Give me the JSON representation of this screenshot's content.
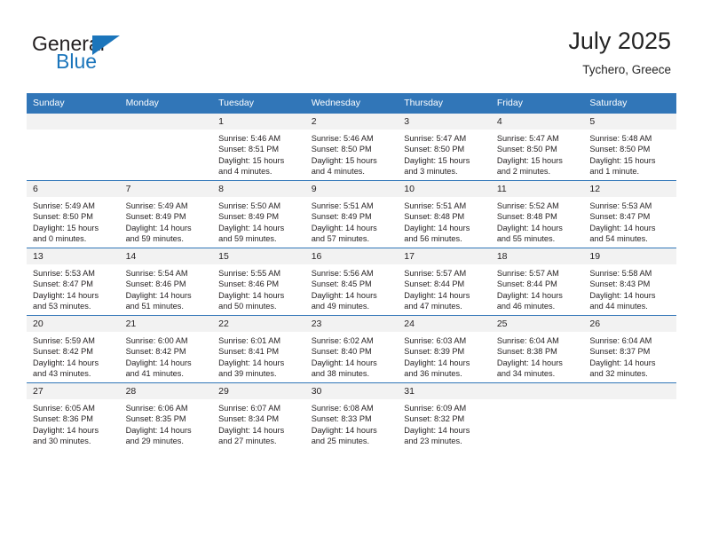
{
  "logo": {
    "word1": "General",
    "word2": "Blue",
    "triangle_color": "#1b75bb"
  },
  "header": {
    "title": "July 2025",
    "subtitle": "Tychero, Greece"
  },
  "theme": {
    "header_blue": "#3176b8",
    "daynum_gray": "#f2f2f2",
    "text": "#231f20"
  },
  "calendar": {
    "weekday_headers": [
      "Sunday",
      "Monday",
      "Tuesday",
      "Wednesday",
      "Thursday",
      "Friday",
      "Saturday"
    ],
    "weeks": [
      [
        {
          "day": "",
          "sunrise": "",
          "sunset": "",
          "daylight1": "",
          "daylight2": ""
        },
        {
          "day": "",
          "sunrise": "",
          "sunset": "",
          "daylight1": "",
          "daylight2": ""
        },
        {
          "day": "1",
          "sunrise": "Sunrise: 5:46 AM",
          "sunset": "Sunset: 8:51 PM",
          "daylight1": "Daylight: 15 hours",
          "daylight2": "and 4 minutes."
        },
        {
          "day": "2",
          "sunrise": "Sunrise: 5:46 AM",
          "sunset": "Sunset: 8:50 PM",
          "daylight1": "Daylight: 15 hours",
          "daylight2": "and 4 minutes."
        },
        {
          "day": "3",
          "sunrise": "Sunrise: 5:47 AM",
          "sunset": "Sunset: 8:50 PM",
          "daylight1": "Daylight: 15 hours",
          "daylight2": "and 3 minutes."
        },
        {
          "day": "4",
          "sunrise": "Sunrise: 5:47 AM",
          "sunset": "Sunset: 8:50 PM",
          "daylight1": "Daylight: 15 hours",
          "daylight2": "and 2 minutes."
        },
        {
          "day": "5",
          "sunrise": "Sunrise: 5:48 AM",
          "sunset": "Sunset: 8:50 PM",
          "daylight1": "Daylight: 15 hours",
          "daylight2": "and 1 minute."
        }
      ],
      [
        {
          "day": "6",
          "sunrise": "Sunrise: 5:49 AM",
          "sunset": "Sunset: 8:50 PM",
          "daylight1": "Daylight: 15 hours",
          "daylight2": "and 0 minutes."
        },
        {
          "day": "7",
          "sunrise": "Sunrise: 5:49 AM",
          "sunset": "Sunset: 8:49 PM",
          "daylight1": "Daylight: 14 hours",
          "daylight2": "and 59 minutes."
        },
        {
          "day": "8",
          "sunrise": "Sunrise: 5:50 AM",
          "sunset": "Sunset: 8:49 PM",
          "daylight1": "Daylight: 14 hours",
          "daylight2": "and 59 minutes."
        },
        {
          "day": "9",
          "sunrise": "Sunrise: 5:51 AM",
          "sunset": "Sunset: 8:49 PM",
          "daylight1": "Daylight: 14 hours",
          "daylight2": "and 57 minutes."
        },
        {
          "day": "10",
          "sunrise": "Sunrise: 5:51 AM",
          "sunset": "Sunset: 8:48 PM",
          "daylight1": "Daylight: 14 hours",
          "daylight2": "and 56 minutes."
        },
        {
          "day": "11",
          "sunrise": "Sunrise: 5:52 AM",
          "sunset": "Sunset: 8:48 PM",
          "daylight1": "Daylight: 14 hours",
          "daylight2": "and 55 minutes."
        },
        {
          "day": "12",
          "sunrise": "Sunrise: 5:53 AM",
          "sunset": "Sunset: 8:47 PM",
          "daylight1": "Daylight: 14 hours",
          "daylight2": "and 54 minutes."
        }
      ],
      [
        {
          "day": "13",
          "sunrise": "Sunrise: 5:53 AM",
          "sunset": "Sunset: 8:47 PM",
          "daylight1": "Daylight: 14 hours",
          "daylight2": "and 53 minutes."
        },
        {
          "day": "14",
          "sunrise": "Sunrise: 5:54 AM",
          "sunset": "Sunset: 8:46 PM",
          "daylight1": "Daylight: 14 hours",
          "daylight2": "and 51 minutes."
        },
        {
          "day": "15",
          "sunrise": "Sunrise: 5:55 AM",
          "sunset": "Sunset: 8:46 PM",
          "daylight1": "Daylight: 14 hours",
          "daylight2": "and 50 minutes."
        },
        {
          "day": "16",
          "sunrise": "Sunrise: 5:56 AM",
          "sunset": "Sunset: 8:45 PM",
          "daylight1": "Daylight: 14 hours",
          "daylight2": "and 49 minutes."
        },
        {
          "day": "17",
          "sunrise": "Sunrise: 5:57 AM",
          "sunset": "Sunset: 8:44 PM",
          "daylight1": "Daylight: 14 hours",
          "daylight2": "and 47 minutes."
        },
        {
          "day": "18",
          "sunrise": "Sunrise: 5:57 AM",
          "sunset": "Sunset: 8:44 PM",
          "daylight1": "Daylight: 14 hours",
          "daylight2": "and 46 minutes."
        },
        {
          "day": "19",
          "sunrise": "Sunrise: 5:58 AM",
          "sunset": "Sunset: 8:43 PM",
          "daylight1": "Daylight: 14 hours",
          "daylight2": "and 44 minutes."
        }
      ],
      [
        {
          "day": "20",
          "sunrise": "Sunrise: 5:59 AM",
          "sunset": "Sunset: 8:42 PM",
          "daylight1": "Daylight: 14 hours",
          "daylight2": "and 43 minutes."
        },
        {
          "day": "21",
          "sunrise": "Sunrise: 6:00 AM",
          "sunset": "Sunset: 8:42 PM",
          "daylight1": "Daylight: 14 hours",
          "daylight2": "and 41 minutes."
        },
        {
          "day": "22",
          "sunrise": "Sunrise: 6:01 AM",
          "sunset": "Sunset: 8:41 PM",
          "daylight1": "Daylight: 14 hours",
          "daylight2": "and 39 minutes."
        },
        {
          "day": "23",
          "sunrise": "Sunrise: 6:02 AM",
          "sunset": "Sunset: 8:40 PM",
          "daylight1": "Daylight: 14 hours",
          "daylight2": "and 38 minutes."
        },
        {
          "day": "24",
          "sunrise": "Sunrise: 6:03 AM",
          "sunset": "Sunset: 8:39 PM",
          "daylight1": "Daylight: 14 hours",
          "daylight2": "and 36 minutes."
        },
        {
          "day": "25",
          "sunrise": "Sunrise: 6:04 AM",
          "sunset": "Sunset: 8:38 PM",
          "daylight1": "Daylight: 14 hours",
          "daylight2": "and 34 minutes."
        },
        {
          "day": "26",
          "sunrise": "Sunrise: 6:04 AM",
          "sunset": "Sunset: 8:37 PM",
          "daylight1": "Daylight: 14 hours",
          "daylight2": "and 32 minutes."
        }
      ],
      [
        {
          "day": "27",
          "sunrise": "Sunrise: 6:05 AM",
          "sunset": "Sunset: 8:36 PM",
          "daylight1": "Daylight: 14 hours",
          "daylight2": "and 30 minutes."
        },
        {
          "day": "28",
          "sunrise": "Sunrise: 6:06 AM",
          "sunset": "Sunset: 8:35 PM",
          "daylight1": "Daylight: 14 hours",
          "daylight2": "and 29 minutes."
        },
        {
          "day": "29",
          "sunrise": "Sunrise: 6:07 AM",
          "sunset": "Sunset: 8:34 PM",
          "daylight1": "Daylight: 14 hours",
          "daylight2": "and 27 minutes."
        },
        {
          "day": "30",
          "sunrise": "Sunrise: 6:08 AM",
          "sunset": "Sunset: 8:33 PM",
          "daylight1": "Daylight: 14 hours",
          "daylight2": "and 25 minutes."
        },
        {
          "day": "31",
          "sunrise": "Sunrise: 6:09 AM",
          "sunset": "Sunset: 8:32 PM",
          "daylight1": "Daylight: 14 hours",
          "daylight2": "and 23 minutes."
        },
        {
          "day": "",
          "sunrise": "",
          "sunset": "",
          "daylight1": "",
          "daylight2": ""
        },
        {
          "day": "",
          "sunrise": "",
          "sunset": "",
          "daylight1": "",
          "daylight2": ""
        }
      ]
    ]
  }
}
